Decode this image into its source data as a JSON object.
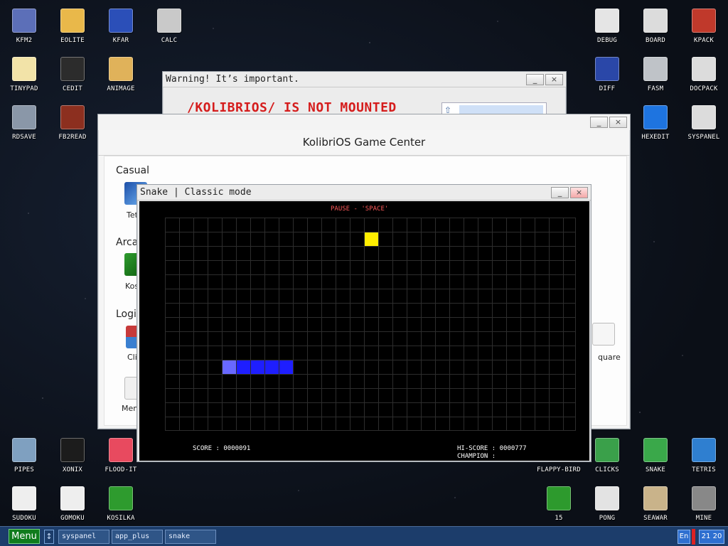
{
  "desktop": {
    "icons": [
      {
        "label": "KFM2",
        "icon": "floppy-icon",
        "color": "#5c6fb8"
      },
      {
        "label": "EOLITE",
        "icon": "folder-icon",
        "color": "#e9b84a"
      },
      {
        "label": "KFAR",
        "icon": "kfar-icon",
        "color": "#2b4fb8"
      },
      {
        "label": "CALC",
        "icon": "calculator-icon",
        "color": "#c9c9c9"
      },
      {
        "label": "TINYPAD",
        "icon": "notepad-icon",
        "color": "#f2e3a8"
      },
      {
        "label": "CEDIT",
        "icon": "code-icon",
        "color": "#2c2c2c"
      },
      {
        "label": "ANIMAGE",
        "icon": "paint-icon",
        "color": "#e0b25a"
      },
      {
        "label": "RDSAVE",
        "icon": "rdsave-icon",
        "color": "#8a97a8"
      },
      {
        "label": "FB2READ",
        "icon": "fb2-icon",
        "color": "#8c2f1f"
      },
      {
        "label": "DEBUG",
        "icon": "bug-icon",
        "color": "#e5e5e5"
      },
      {
        "label": "BOARD",
        "icon": "board-icon",
        "color": "#dcdcdc"
      },
      {
        "label": "KPACK",
        "icon": "hammer-icon",
        "color": "#c0392b"
      },
      {
        "label": "DIFF",
        "icon": "diff-icon",
        "color": "#2a47a8"
      },
      {
        "label": "FASM",
        "icon": "fasm-icon",
        "color": "#bfc3c8"
      },
      {
        "label": "DOCPACK",
        "icon": "cabinet-icon",
        "color": "#dcdcdc"
      },
      {
        "label": "HEXEDIT",
        "icon": "hex-icon",
        "color": "#1e74e0"
      },
      {
        "label": "SYSPANEL",
        "icon": "sliders-icon",
        "color": "#dcdcdc"
      },
      {
        "label": "PIPES",
        "icon": "pipes-icon",
        "color": "#7fa0c0"
      },
      {
        "label": "XONIX",
        "icon": "xonix-icon",
        "color": "#1c1c1c"
      },
      {
        "label": "FLOOD-IT",
        "icon": "floodit-icon",
        "color": "#e84a5f"
      },
      {
        "label": "SUDOKU",
        "icon": "sudoku-icon",
        "color": "#eeeeee"
      },
      {
        "label": "GOMOKU",
        "icon": "gomoku-icon",
        "color": "#eeeeee"
      },
      {
        "label": "KOSILKA",
        "icon": "mower-icon",
        "color": "#2e9b2e"
      },
      {
        "label": "FLAPPY-BIRD",
        "icon": "flappy-icon",
        "color": "#1c1c1c"
      },
      {
        "label": "CLICKS",
        "icon": "clicks-icon",
        "color": "#3aa04a"
      },
      {
        "label": "SNAKE",
        "icon": "snake-icon",
        "color": "#3aa84a"
      },
      {
        "label": "TETRIS",
        "icon": "tetris-icon",
        "color": "#2f7fd0"
      },
      {
        "label": "15",
        "icon": "fifteen-icon",
        "color": "#2d9a2d"
      },
      {
        "label": "PONG",
        "icon": "pong-icon",
        "color": "#e3e3e3"
      },
      {
        "label": "SEAWAR",
        "icon": "ship-icon",
        "color": "#c9b38a"
      },
      {
        "label": "MINE",
        "icon": "mine-icon",
        "color": "#888888"
      }
    ]
  },
  "warning_window": {
    "title": "Warning! It’s important.",
    "message": "/KOLIBRIOS/ IS NOT MOUNTED",
    "minimize": "_",
    "close": "×"
  },
  "game_center": {
    "title": "KolibriOS Game Center",
    "minimize": "_",
    "close": "×",
    "sections": [
      "Casual",
      "Arcad",
      "Logica"
    ],
    "visible_labels": [
      "Tetr",
      "Kosil",
      "Click",
      "Memo",
      "quare"
    ]
  },
  "snake_window": {
    "title": "Snake | Classic mode",
    "minimize": "_",
    "close": "×",
    "pause_text": "PAUSE - 'SPACE'",
    "score_text": "SCORE : 0000091",
    "hiscore_text": "HI-SCORE : 0000777",
    "champion_text": "CHAMPION :",
    "colors": {
      "food": "#ffee00",
      "snake_head": "#6868ff",
      "snake_body": "#1e1eff",
      "pause": "#ff5a5a",
      "text": "#ffffff"
    }
  },
  "taskbar": {
    "menu_label": "Menu",
    "switch_icon": "↕",
    "tasks": [
      "syspanel",
      "app_plus",
      "snake"
    ],
    "language": "En",
    "clock": "21 20"
  }
}
